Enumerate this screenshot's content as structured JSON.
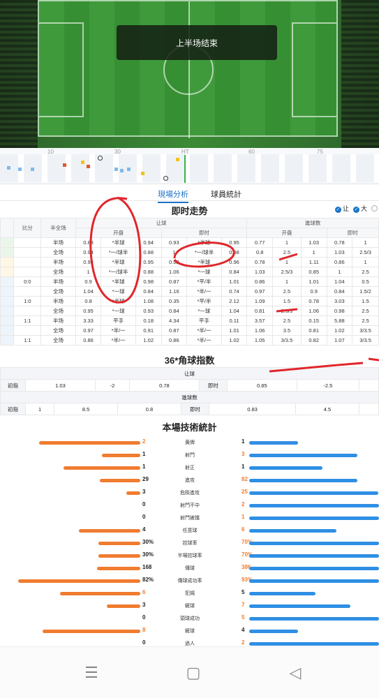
{
  "match_status": "上半场结束",
  "timeline_ticks": [
    "10",
    "30",
    "HT",
    "60",
    "75"
  ],
  "tabs": [
    "現場分析",
    "球員統計"
  ],
  "live_title": "即时走势",
  "legend": [
    "让",
    "大"
  ],
  "odds": {
    "col_score": "比分",
    "col_half": "半全场",
    "grp_rang": "让球",
    "grp_jq": "進球数",
    "sub_open": "开盘",
    "sub_now": "即时",
    "rows": [
      {
        "score": "",
        "half": "半场",
        "a": "0.88",
        "b": "*半球",
        "c": "0.94",
        "d": "0.93",
        "e": "*半球",
        "f": "0.95",
        "g": "0.77",
        "h": "1",
        "i": "1.03",
        "j": "0.78",
        "k": "1"
      },
      {
        "score": "",
        "half": "全场",
        "a": "0.94",
        "b": "*一/球半",
        "c": "0.88",
        "d": "1",
        "e": "*一/球半",
        "f": "0.88",
        "g": "0.8",
        "h": "2.5",
        "i": "1",
        "j": "1.03",
        "k": "2.5/3"
      },
      {
        "score": "",
        "half": "半场",
        "a": "0.93",
        "b": "*半球",
        "c": "0.95",
        "d": "0.92",
        "e": "*半球",
        "f": "0.96",
        "g": "0.78",
        "h": "1",
        "i": "1.11",
        "j": "0.86",
        "k": "1"
      },
      {
        "score": "",
        "half": "全场",
        "a": "1",
        "b": "*一/球半",
        "c": "0.88",
        "d": "1.06",
        "e": "*一球",
        "f": "0.84",
        "g": "1.03",
        "h": "2.5/3",
        "i": "0.85",
        "j": "1",
        "k": "2.5"
      },
      {
        "score": "0:0",
        "half": "半场",
        "a": "0.9",
        "b": "*半球",
        "c": "0.98",
        "d": "0.87",
        "e": "*平/半",
        "f": "1.01",
        "g": "0.86",
        "h": "1",
        "i": "1.01",
        "j": "1.04",
        "k": "0.5"
      },
      {
        "score": "",
        "half": "全场",
        "a": "1.04",
        "b": "*一球",
        "c": "0.84",
        "d": "1.16",
        "e": "*半/一",
        "f": "0.74",
        "g": "0.97",
        "h": "2.5",
        "i": "0.9",
        "j": "0.84",
        "k": "1.5/2"
      },
      {
        "score": "1:0",
        "half": "半场",
        "a": "0.8",
        "b": "*半球",
        "c": "1.08",
        "d": "0.35",
        "e": "*平/半",
        "f": "2.12",
        "g": "1.09",
        "h": "1.5",
        "i": "0.78",
        "j": "3.03",
        "k": "1.5"
      },
      {
        "score": "",
        "half": "全场",
        "a": "0.95",
        "b": "*一球",
        "c": "0.93",
        "d": "0.84",
        "e": "*一球",
        "f": "1.04",
        "g": "0.81",
        "h": "2.5/3",
        "i": "1.06",
        "j": "0.98",
        "k": "2.5"
      },
      {
        "score": "1:1",
        "half": "半场",
        "a": "3.33",
        "b": "平手",
        "c": "0.18",
        "d": "4.34",
        "e": "平手",
        "f": "0.11",
        "g": "3.57",
        "h": "2.5",
        "i": "0.15",
        "j": "5.88",
        "k": "2.5"
      },
      {
        "score": "",
        "half": "全场",
        "a": "0.97",
        "b": "*半/一",
        "c": "0.91",
        "d": "0.87",
        "e": "*半/一",
        "f": "1.01",
        "g": "1.06",
        "h": "3.5",
        "i": "0.81",
        "j": "1.02",
        "k": "3/3.5"
      },
      {
        "score": "1:1",
        "half": "全场",
        "a": "0.86",
        "b": "*半/一",
        "c": "1.02",
        "d": "0.86",
        "e": "*半/一",
        "f": "1.02",
        "g": "1.05",
        "h": "3/3.5",
        "i": "0.82",
        "j": "1.07",
        "k": "3/3.5"
      }
    ]
  },
  "corner": {
    "title": "36*角球指数",
    "rang": {
      "label": "让球",
      "init": "初指",
      "a": "1.03",
      "b": "-2",
      "c": "0.78",
      "now": "即时",
      "d": "0.85",
      "e": "-2.5"
    },
    "jq": {
      "label": "進球数",
      "init": "初指",
      "a": "1",
      "b": "8.5",
      "c": "0.8",
      "now": "即时",
      "d": "0.83",
      "e": "4.5"
    }
  },
  "stats_title": "本場技術統計",
  "stats": [
    {
      "name": "黄牌",
      "l": "2",
      "r": "1",
      "lw": 145,
      "rw": 70
    },
    {
      "name": "射門",
      "l": "1",
      "r": "3",
      "lw": 55,
      "rw": 155
    },
    {
      "name": "射正",
      "l": "1",
      "r": "1",
      "lw": 110,
      "rw": 105
    },
    {
      "name": "進攻",
      "l": "29",
      "r": "82",
      "lw": 58,
      "rw": 155
    },
    {
      "name": "危險進攻",
      "l": "3",
      "r": "25",
      "lw": 20,
      "rw": 185
    },
    {
      "name": "射門不中",
      "l": "0",
      "r": "2",
      "lw": 0,
      "rw": 186
    },
    {
      "name": "射門被擋",
      "l": "0",
      "r": "1",
      "lw": 0,
      "rw": 186
    },
    {
      "name": "任意球",
      "l": "4",
      "r": "6",
      "lw": 88,
      "rw": 125
    },
    {
      "name": "控球率",
      "l": "30%",
      "r": "70%",
      "lw": 60,
      "rw": 186
    },
    {
      "name": "半場控球率",
      "l": "30%",
      "r": "70%",
      "lw": 60,
      "rw": 186
    },
    {
      "name": "傳球",
      "l": "168",
      "r": "386",
      "lw": 62,
      "rw": 186
    },
    {
      "name": "傳球成功率",
      "l": "82%",
      "r": "93%",
      "lw": 175,
      "rw": 186
    },
    {
      "name": "犯規",
      "l": "6",
      "r": "5",
      "lw": 115,
      "rw": 95
    },
    {
      "name": "鏟球",
      "l": "3",
      "r": "7",
      "lw": 48,
      "rw": 145
    },
    {
      "name": "頭球成功",
      "l": "0",
      "r": "5",
      "lw": 0,
      "rw": 186
    },
    {
      "name": "鏟球",
      "l": "8",
      "r": "4",
      "lw": 140,
      "rw": 70
    },
    {
      "name": "過人",
      "l": "0",
      "r": "2",
      "lw": 0,
      "rw": 186
    }
  ],
  "colors": {
    "home": "#f07c30",
    "away": "#2f8fe4",
    "accent": "#1a73c8",
    "annotation": "#e0262b"
  }
}
